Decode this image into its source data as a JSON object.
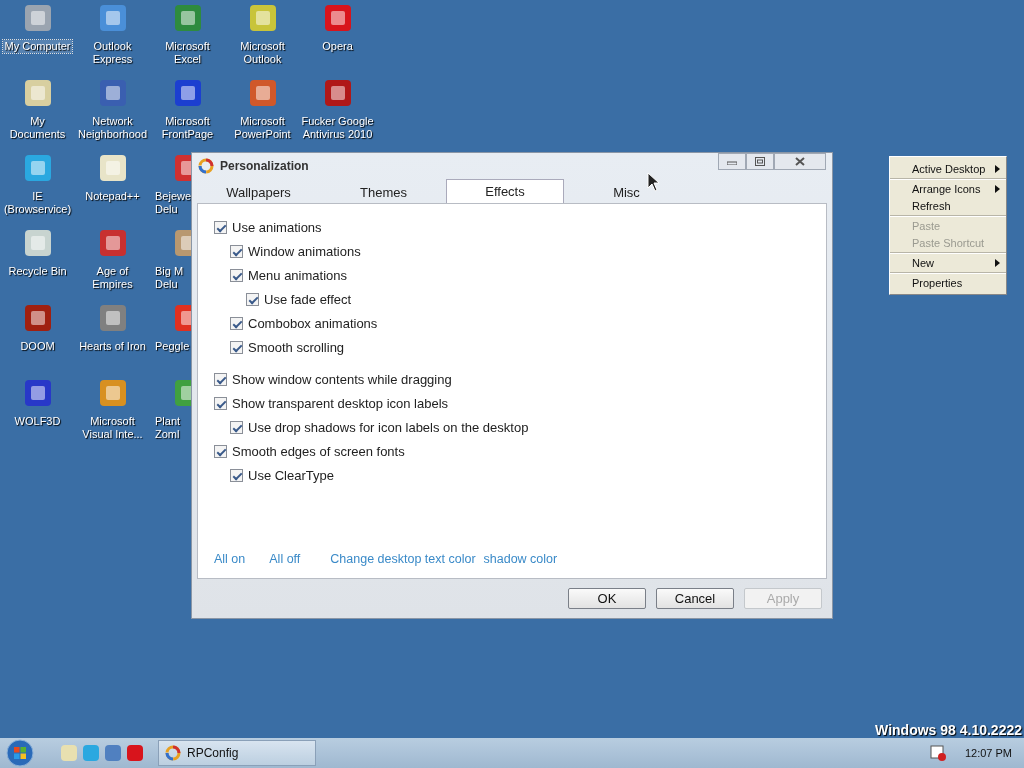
{
  "desktop_icon_columns": [
    [
      {
        "label": "My Computer",
        "color": "#9aa4b0",
        "selected": true,
        "clipped": false
      },
      {
        "label": "My Documents",
        "color": "#d8cfa0",
        "selected": false,
        "clipped": false
      },
      {
        "label": "IE (Browservice)",
        "color": "#2aa8e0",
        "selected": false,
        "clipped": false
      },
      {
        "label": "Recycle Bin",
        "color": "#c8d4d0",
        "selected": false,
        "clipped": false
      },
      {
        "label": "DOOM",
        "color": "#a02010",
        "selected": false,
        "clipped": false
      },
      {
        "label": "WOLF3D",
        "color": "#2838c8",
        "selected": false,
        "clipped": false
      }
    ],
    [
      {
        "label": "Outlook Express",
        "color": "#4a8fd8",
        "selected": false,
        "clipped": false
      },
      {
        "label": "Network Neighborhood",
        "color": "#3a5fb0",
        "selected": false,
        "clipped": false
      },
      {
        "label": "Notepad++",
        "color": "#e8e4c8",
        "selected": false,
        "clipped": false
      },
      {
        "label": "Age of Empires",
        "color": "#c83030",
        "selected": false,
        "clipped": false
      },
      {
        "label": "Hearts of Iron",
        "color": "#808080",
        "selected": false,
        "clipped": false
      },
      {
        "label": "Microsoft Visual Inte...",
        "color": "#d89020",
        "selected": false,
        "clipped": false
      }
    ],
    [
      {
        "label": "Microsoft Excel",
        "color": "#2e8b3e",
        "selected": false,
        "clipped": false
      },
      {
        "label": "Microsoft FrontPage",
        "color": "#1c3fd0",
        "selected": false,
        "clipped": false
      },
      {
        "label": "Bejewe Delu",
        "color": "#d03030",
        "selected": false,
        "clipped": true
      },
      {
        "label": "Big M Delu",
        "color": "#b89870",
        "selected": false,
        "clipped": true
      },
      {
        "label": "Peggle",
        "color": "#e03020",
        "selected": false,
        "clipped": true
      },
      {
        "label": "Plant Zoml",
        "color": "#40a040",
        "selected": false,
        "clipped": true
      }
    ],
    [
      {
        "label": "Microsoft Outlook",
        "color": "#c8c43a",
        "selected": false,
        "clipped": false
      },
      {
        "label": "Microsoft PowerPoint",
        "color": "#d0582a",
        "selected": false,
        "clipped": false
      }
    ],
    [
      {
        "label": "Opera",
        "color": "#d8141c",
        "selected": false,
        "clipped": false
      },
      {
        "label": "Fucker Google Antivirus 2010",
        "color": "#b01818",
        "selected": false,
        "clipped": false
      }
    ]
  ],
  "version_text": "Windows 98 4.10.2222",
  "window": {
    "title": "Personalization",
    "tabs": [
      {
        "label": "Wallpapers",
        "selected": false
      },
      {
        "label": "Themes",
        "selected": false
      },
      {
        "label": "Effects",
        "selected": true
      },
      {
        "label": "Misc",
        "selected": false
      }
    ],
    "option_groups": [
      [
        {
          "label": "Use animations",
          "checked": true,
          "children": [
            {
              "label": "Window animations",
              "checked": true
            },
            {
              "label": "Menu animations",
              "checked": true,
              "children": [
                {
                  "label": "Use fade effect",
                  "checked": true
                }
              ]
            },
            {
              "label": "Combobox animations",
              "checked": true
            },
            {
              "label": "Smooth scrolling",
              "checked": true
            }
          ]
        }
      ],
      [
        {
          "label": "Show window contents while dragging",
          "checked": true
        },
        {
          "label": "Show transparent desktop icon labels",
          "checked": true,
          "children": [
            {
              "label": "Use drop shadows for icon labels on the desktop",
              "checked": true
            }
          ]
        },
        {
          "label": "Smooth edges of screen fonts",
          "checked": true,
          "children": [
            {
              "label": "Use ClearType",
              "checked": true
            }
          ]
        }
      ]
    ],
    "links": [
      "All on",
      "All off",
      "Change desktop text color",
      "shadow color"
    ],
    "buttons": [
      {
        "label": "OK",
        "disabled": false
      },
      {
        "label": "Cancel",
        "disabled": false
      },
      {
        "label": "Apply",
        "disabled": true
      }
    ]
  },
  "context_menu": [
    [
      {
        "label": "Active Desktop",
        "submenu": true,
        "disabled": false
      }
    ],
    [
      {
        "label": "Arrange Icons",
        "submenu": true,
        "disabled": false
      },
      {
        "label": "Refresh",
        "submenu": false,
        "disabled": false
      }
    ],
    [
      {
        "label": "Paste",
        "submenu": false,
        "disabled": true
      },
      {
        "label": "Paste Shortcut",
        "submenu": false,
        "disabled": true
      }
    ],
    [
      {
        "label": "New",
        "submenu": true,
        "disabled": false
      }
    ],
    [
      {
        "label": "Properties",
        "submenu": false,
        "disabled": false
      }
    ]
  ],
  "taskbar": {
    "quick_launch": [
      {
        "color": "#e8e0b0"
      },
      {
        "color": "#2aa8e0"
      },
      {
        "color": "#5080c0"
      },
      {
        "color": "#d8141c"
      }
    ],
    "tasks": [
      {
        "label": "RPConfig",
        "selected": false
      }
    ],
    "clock": "12:07 PM"
  }
}
